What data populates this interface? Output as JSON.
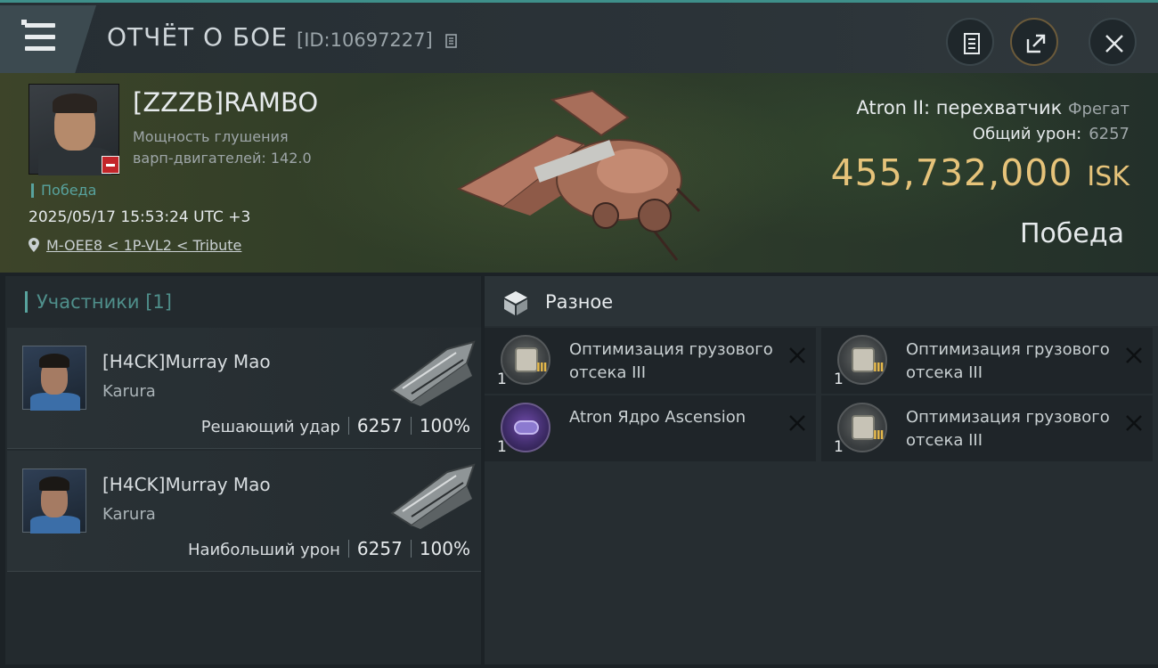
{
  "header": {
    "title": "ОТЧЁТ О БОЕ",
    "report_id": "[ID:10697227]"
  },
  "victim": {
    "name": "[ZZZB]RAMBO",
    "stat_line1": "Мощность глушения",
    "stat_line2": "варп-двигателей: 142.0",
    "result": "Победа",
    "datetime": "2025/05/17 15:53:24 UTC +3",
    "location": "M-OEE8 < 1P-VL2 < Tribute"
  },
  "ship": {
    "name": "Atron II: перехватчик",
    "class": "Фрегат",
    "damage_label": "Общий урон:",
    "damage_value": "6257",
    "isk_value": "455,732,000",
    "isk_unit": "ISK",
    "outcome": "Победа"
  },
  "participants": {
    "title": "Участники [1]",
    "items": [
      {
        "name": "[H4CK]Murray Mao",
        "ship": "Karura",
        "role": "Решающий удар",
        "damage": "6257",
        "percent": "100%"
      },
      {
        "name": "[H4CK]Murray Mao",
        "ship": "Karura",
        "role": "Наибольший урон",
        "damage": "6257",
        "percent": "100%"
      }
    ]
  },
  "misc": {
    "title": "Разное",
    "items": [
      {
        "qty": "1",
        "name": "Оптимизация грузового отсека III",
        "tier": "III"
      },
      {
        "qty": "1",
        "name": "Оптимизация грузового отсека III",
        "tier": "III"
      },
      {
        "qty": "1",
        "name": "Atron Ядро Ascension",
        "tier": ""
      },
      {
        "qty": "1",
        "name": "Оптимизация грузового отсека III",
        "tier": "III"
      }
    ]
  },
  "colors": {
    "accent_teal": "#58a39e",
    "isk_gold": "#e6c37a",
    "negative_badge": "#c3252a",
    "tier_gold": "#e5b84a"
  },
  "icons": [
    "menu-icon",
    "copy-icon",
    "clipboard-icon",
    "share-icon",
    "close-icon",
    "location-pin-icon",
    "cube-icon",
    "remove-x-icon"
  ]
}
